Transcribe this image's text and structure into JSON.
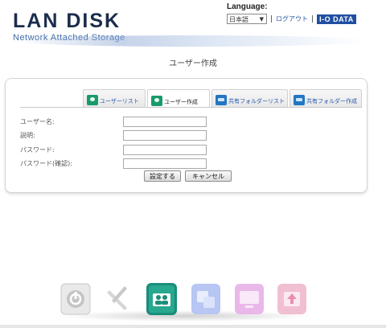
{
  "header": {
    "logo_main": "LAN DISK",
    "logo_sub": "Network Attached Storage",
    "language_label": "Language:",
    "language_value": "日本語",
    "separator": "|",
    "logout": "ログアウト",
    "brand": "I-O DATA"
  },
  "page": {
    "title": "ユーザー作成"
  },
  "tabs": [
    {
      "label": "ユーザーリスト",
      "icon": "user-icon",
      "active": false
    },
    {
      "label": "ユーザー作成",
      "icon": "user-add-icon",
      "active": true
    },
    {
      "label": "共有フォルダーリスト",
      "icon": "folder-icon",
      "active": false
    },
    {
      "label": "共有フォルダー作成",
      "icon": "folder-add-icon",
      "active": false
    }
  ],
  "form": {
    "fields": [
      {
        "label": "ユーザー名:",
        "value": ""
      },
      {
        "label": "説明:",
        "value": ""
      },
      {
        "label": "パスワード:",
        "value": ""
      },
      {
        "label": "パスワード(確認):",
        "value": ""
      }
    ],
    "submit_label": "設定する",
    "cancel_label": "キャンセル"
  },
  "dock": [
    {
      "name": "power-icon",
      "color": "#9a9a9a",
      "active": false
    },
    {
      "name": "tools-icon",
      "color": "#b0b0b0",
      "active": false
    },
    {
      "name": "users-icon",
      "color": "#1d9a84",
      "active": true
    },
    {
      "name": "share-icon",
      "color": "#8aa2e8",
      "active": false
    },
    {
      "name": "monitor-icon",
      "color": "#d891d8",
      "active": false
    },
    {
      "name": "export-icon",
      "color": "#e890b0",
      "active": false
    }
  ]
}
